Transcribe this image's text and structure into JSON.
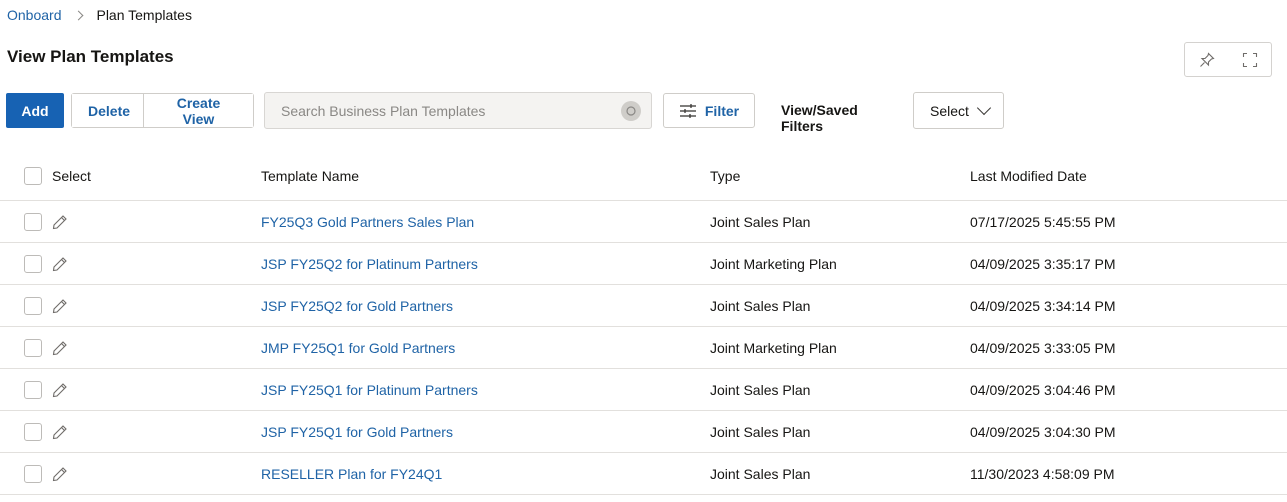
{
  "breadcrumb": {
    "root": "Onboard",
    "current": "Plan Templates"
  },
  "page_title": "View Plan Templates",
  "toolbar": {
    "add_label": "Add",
    "delete_label": "Delete",
    "create_view_label": "Create View",
    "search_placeholder": "Search Business Plan Templates",
    "filter_label": "Filter",
    "saved_filters_label": "View/Saved Filters",
    "select_label": "Select"
  },
  "table": {
    "headers": {
      "select": "Select",
      "name": "Template Name",
      "type": "Type",
      "date": "Last Modified Date"
    },
    "rows": [
      {
        "name": "FY25Q3 Gold Partners Sales Plan",
        "type": "Joint Sales Plan",
        "date": "07/17/2025 5:45:55 PM"
      },
      {
        "name": "JSP FY25Q2 for Platinum Partners",
        "type": "Joint Marketing Plan",
        "date": "04/09/2025 3:35:17 PM"
      },
      {
        "name": "JSP FY25Q2 for Gold Partners",
        "type": "Joint Sales Plan",
        "date": "04/09/2025 3:34:14 PM"
      },
      {
        "name": "JMP FY25Q1 for Gold Partners",
        "type": "Joint Marketing Plan",
        "date": "04/09/2025 3:33:05 PM"
      },
      {
        "name": "JSP FY25Q1 for Platinum Partners",
        "type": "Joint Sales Plan",
        "date": "04/09/2025 3:04:46 PM"
      },
      {
        "name": "JSP FY25Q1 for Gold Partners",
        "type": "Joint Sales Plan",
        "date": "04/09/2025 3:04:30 PM"
      },
      {
        "name": "RESELLER Plan for FY24Q1",
        "type": "Joint Sales Plan",
        "date": "11/30/2023 4:58:09 PM"
      }
    ]
  },
  "colors": {
    "primary": "#1762b3",
    "link": "#1f63a6",
    "text": "#161513",
    "border": "#e2e0dd"
  },
  "icons": [
    "chevron-right-icon",
    "pin-icon",
    "fullscreen-icon",
    "search-icon",
    "filter-icon",
    "chevron-down-icon",
    "pencil-icon"
  ]
}
